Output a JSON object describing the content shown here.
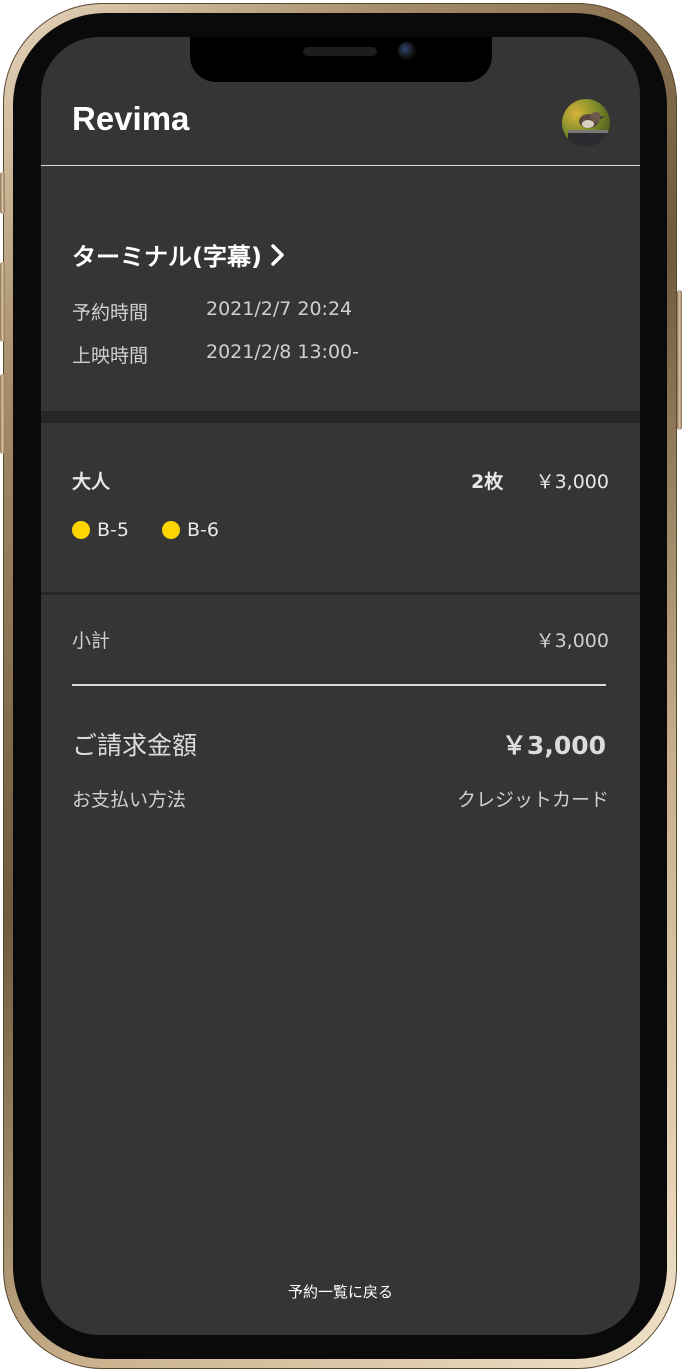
{
  "app": {
    "brand": "Revima"
  },
  "movie": {
    "title": "ターミナル(字幕)"
  },
  "booking": {
    "reserved_label": "予約時間",
    "reserved_value": "2021/2/7 20:24",
    "showtime_label": "上映時間",
    "showtime_value": "2021/2/8 13:00-"
  },
  "ticket": {
    "type": "大人",
    "count": "2枚",
    "price": "￥3,000",
    "seats": [
      "B-5",
      "B-6"
    ],
    "seat_color": "#ffd600"
  },
  "summary": {
    "subtotal_label": "小計",
    "subtotal_value": "￥3,000",
    "total_label": "ご請求金額",
    "total_value": "￥3,000",
    "payment_label": "お支払い方法",
    "payment_value": "クレジットカード"
  },
  "footer": {
    "back_label": "予約一覧に戻る"
  },
  "icons": {
    "title_chevron": "chevron-right-icon",
    "avatar": "bird-avatar"
  },
  "colors": {
    "screen_bg": "#353535",
    "accent_dot": "#ffd600",
    "text": "#ffffff"
  }
}
